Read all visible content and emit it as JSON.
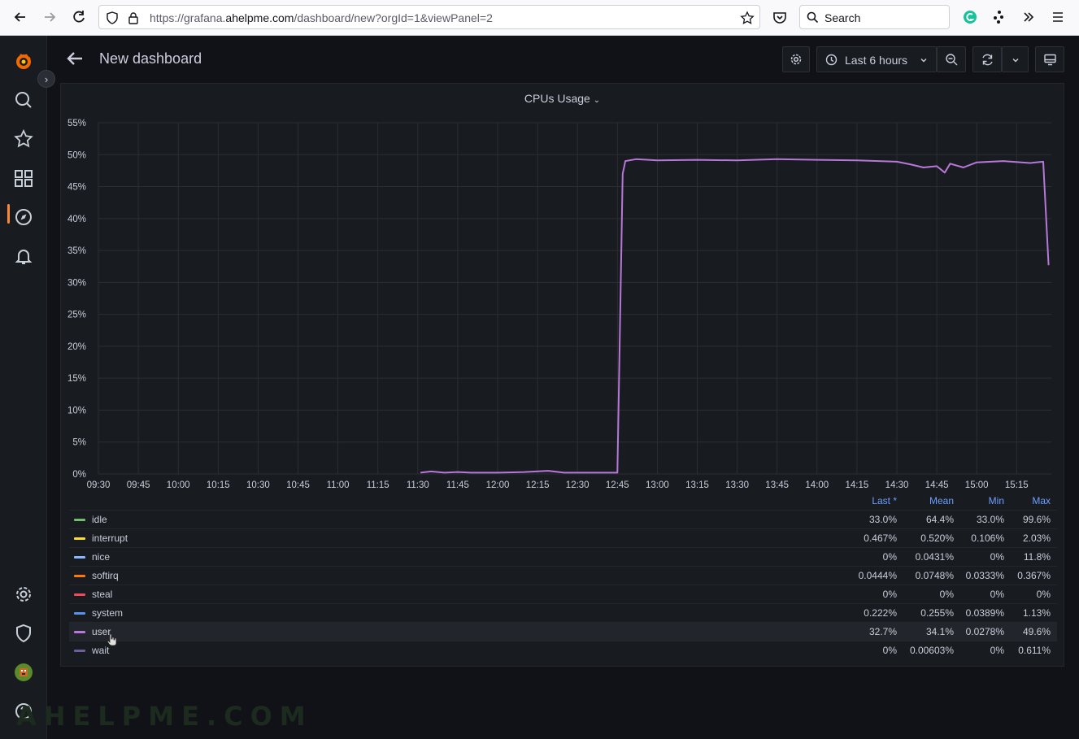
{
  "browser": {
    "url_prefix": "https://grafana.",
    "url_domain": "ahelpme.com",
    "url_suffix": "/dashboard/new?orgId=1&viewPanel=2",
    "search_placeholder": "Search"
  },
  "header": {
    "title": "New dashboard",
    "time_range": "Last 6 hours"
  },
  "panel": {
    "title": "CPUs Usage"
  },
  "legend": {
    "columns": [
      "Last *",
      "Mean",
      "Min",
      "Max"
    ],
    "rows": [
      {
        "name": "idle",
        "color": "#73bf69",
        "last": "33.0%",
        "mean": "64.4%",
        "min": "33.0%",
        "max": "99.6%"
      },
      {
        "name": "interrupt",
        "color": "#fade2a",
        "last": "0.467%",
        "mean": "0.520%",
        "min": "0.106%",
        "max": "2.03%"
      },
      {
        "name": "nice",
        "color": "#8ab8ff",
        "last": "0%",
        "mean": "0.0431%",
        "min": "0%",
        "max": "11.8%"
      },
      {
        "name": "softirq",
        "color": "#ff780a",
        "last": "0.0444%",
        "mean": "0.0748%",
        "min": "0.0333%",
        "max": "0.367%"
      },
      {
        "name": "steal",
        "color": "#f2495c",
        "last": "0%",
        "mean": "0%",
        "min": "0%",
        "max": "0%"
      },
      {
        "name": "system",
        "color": "#5794f2",
        "last": "0.222%",
        "mean": "0.255%",
        "min": "0.0389%",
        "max": "1.13%"
      },
      {
        "name": "user",
        "color": "#b877d9",
        "last": "32.7%",
        "mean": "34.1%",
        "min": "0.0278%",
        "max": "49.6%"
      },
      {
        "name": "wait",
        "color": "#705da0",
        "last": "0%",
        "mean": "0.00603%",
        "min": "0%",
        "max": "0.611%"
      }
    ]
  },
  "chart_data": {
    "type": "line",
    "title": "CPUs Usage",
    "x_ticks": [
      "09:30",
      "09:45",
      "10:00",
      "10:15",
      "10:30",
      "10:45",
      "11:00",
      "11:15",
      "11:30",
      "11:45",
      "12:00",
      "12:15",
      "12:30",
      "12:45",
      "13:00",
      "13:15",
      "13:30",
      "13:45",
      "14:00",
      "14:15",
      "14:30",
      "14:45",
      "15:00",
      "15:15"
    ],
    "y_ticks": [
      "0%",
      "5%",
      "10%",
      "15%",
      "20%",
      "25%",
      "30%",
      "35%",
      "40%",
      "45%",
      "50%",
      "55%"
    ],
    "ylim": [
      0,
      55
    ],
    "xlim": [
      "09:30",
      "15:27"
    ],
    "grid": true,
    "series": [
      {
        "name": "user",
        "color": "#b877d9",
        "points": [
          [
            "11:31",
            0.2
          ],
          [
            "11:35",
            0.4
          ],
          [
            "11:40",
            0.2
          ],
          [
            "11:45",
            0.3
          ],
          [
            "11:50",
            0.2
          ],
          [
            "12:00",
            0.2
          ],
          [
            "12:10",
            0.3
          ],
          [
            "12:19",
            0.5
          ],
          [
            "12:25",
            0.2
          ],
          [
            "12:35",
            0.2
          ],
          [
            "12:45",
            0.2
          ],
          [
            "12:47",
            47
          ],
          [
            "12:48",
            49
          ],
          [
            "12:52",
            49.3
          ],
          [
            "13:00",
            49.1
          ],
          [
            "13:15",
            49.2
          ],
          [
            "13:30",
            49.1
          ],
          [
            "13:45",
            49.3
          ],
          [
            "14:00",
            49.2
          ],
          [
            "14:15",
            49.1
          ],
          [
            "14:30",
            48.9
          ],
          [
            "14:35",
            48.5
          ],
          [
            "14:40",
            48.0
          ],
          [
            "14:45",
            48.2
          ],
          [
            "14:48",
            47.2
          ],
          [
            "14:50",
            48.6
          ],
          [
            "14:55",
            48.0
          ],
          [
            "15:00",
            48.8
          ],
          [
            "15:10",
            49.0
          ],
          [
            "15:20",
            48.7
          ],
          [
            "15:25",
            48.9
          ],
          [
            "15:27",
            32.7
          ]
        ]
      }
    ]
  }
}
